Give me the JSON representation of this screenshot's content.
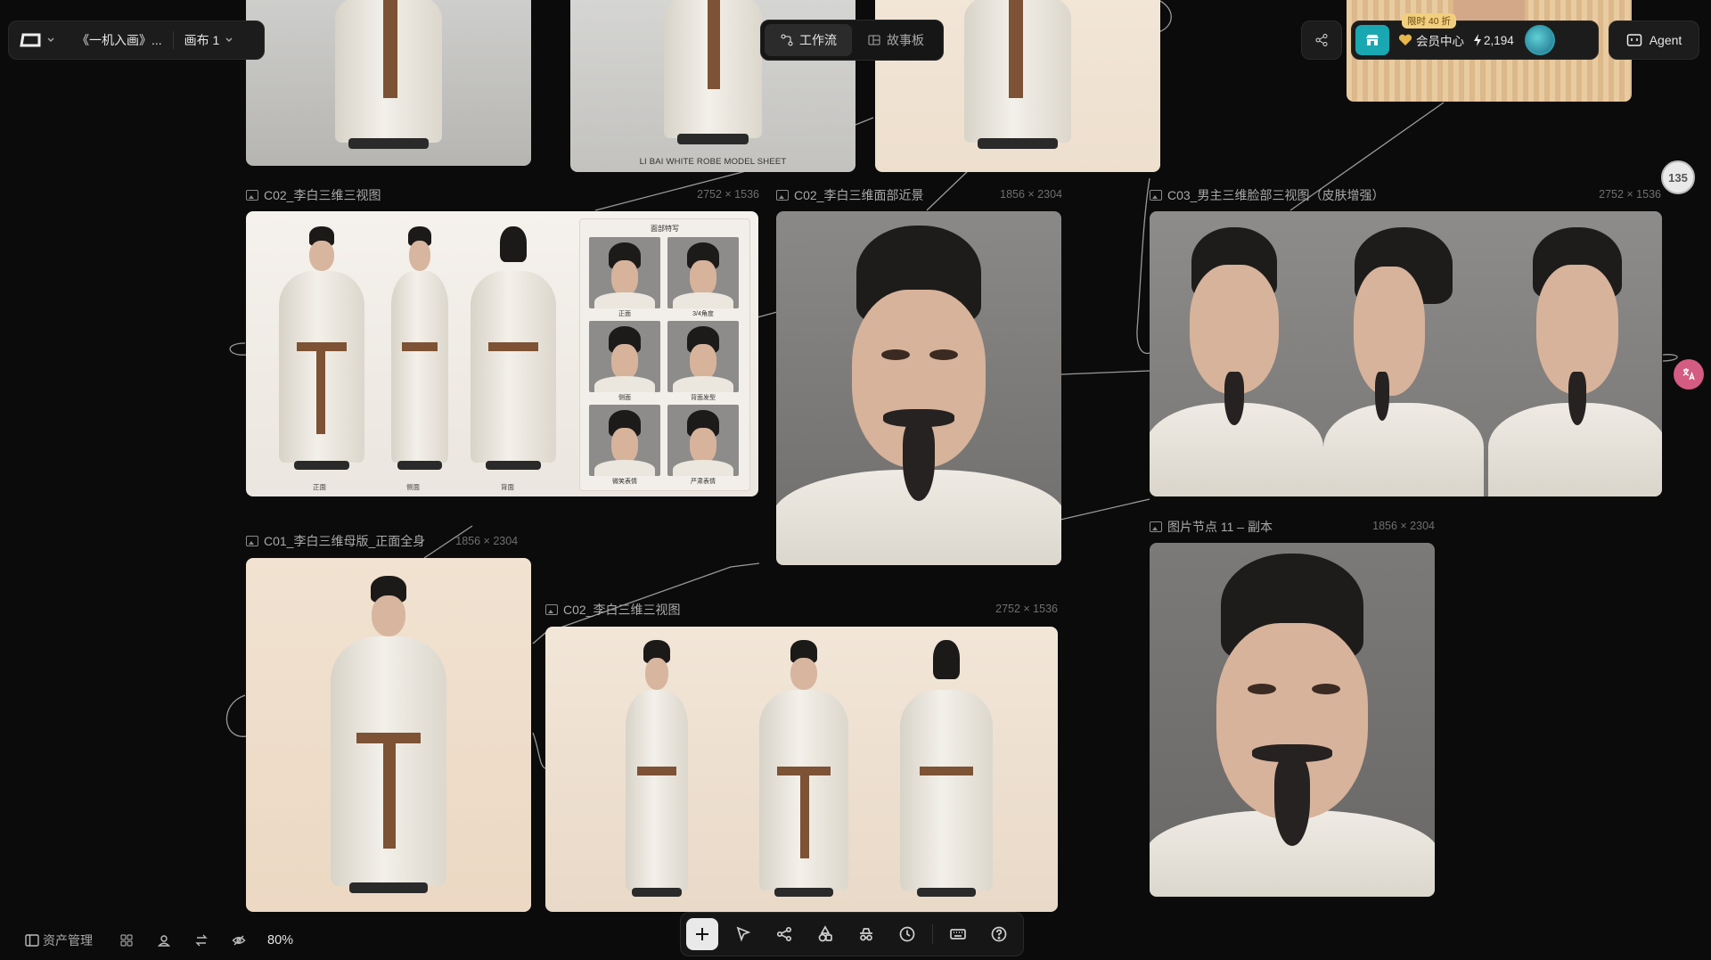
{
  "header": {
    "project_title": "《一机入画》...",
    "canvas_label": "画布 1",
    "tab_workflow": "工作流",
    "tab_storyboard": "故事板",
    "promo_badge": "限时 40 折",
    "member_center": "会员中心",
    "credits": "2,194",
    "agent_label": "Agent"
  },
  "nodes": {
    "top_sheet_caption": "LI BAI WHITE ROBE MODEL SHEET",
    "n1": {
      "title": "C02_李白三维三视图",
      "size": "2752 × 1536"
    },
    "n2": {
      "title": "C02_李白三维面部近景",
      "size": "1856 × 2304"
    },
    "n3": {
      "title": "C03_男主三维脸部三视图（皮肤增强）",
      "size": "2752 × 1536"
    },
    "n4": {
      "title": "C01_李白三维母版_正面全身",
      "size": "1856 × 2304"
    },
    "n5": {
      "title": "C02_李白三维三视图",
      "size": "2752 × 1536"
    },
    "n6": {
      "title": "图片节点 11 – 副本",
      "size": "1856 × 2304"
    },
    "sheet": {
      "panel_title": "面部特写",
      "labels": [
        "正面",
        "侧面",
        "背面"
      ],
      "face_labels": [
        "正面",
        "3/4角度",
        "侧面",
        "背面发型",
        "微笑表情",
        "严肃表情"
      ]
    }
  },
  "footer": {
    "assets_label": "资产管理",
    "zoom": "80%"
  },
  "side": {
    "badge_text": "135"
  },
  "colors": {
    "background": "#0b0b0b",
    "accent_teal": "#19a7b1",
    "gold": "#e7b74a",
    "translate_pink": "#d45b82"
  }
}
